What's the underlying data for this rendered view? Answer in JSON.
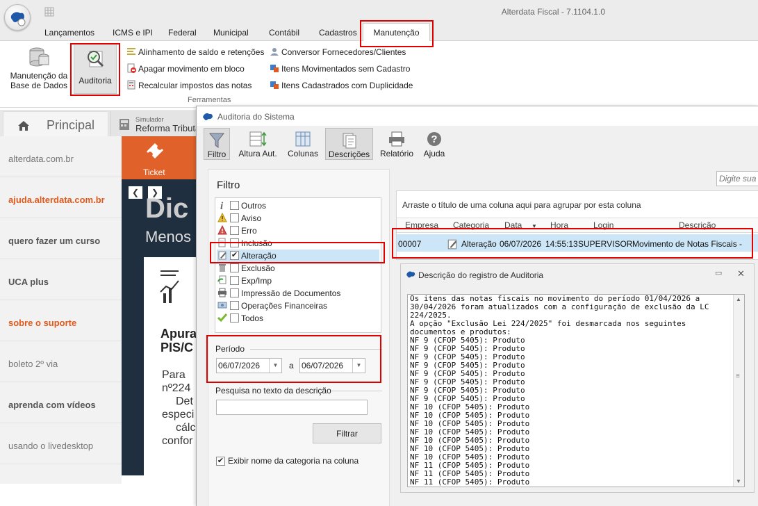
{
  "app": {
    "title": "Alterdata Fiscal - 7.1104.1.0"
  },
  "menu": [
    "Lançamentos",
    "ICMS e IPI",
    "Federal",
    "Municipal",
    "Contábil",
    "Cadastros",
    "Manutenção"
  ],
  "ribbon": {
    "big_buttons": [
      {
        "label_line1": "Manutenção da",
        "label_line2": "Base de Dados"
      },
      {
        "label_line1": "Auditoria"
      }
    ],
    "col1": [
      "Alinhamento de saldo e retenções",
      "Apagar movimento em bloco",
      "Recalcular impostos das notas"
    ],
    "col2": [
      "Conversor Fornecedores/Clientes",
      "Itens Movimentados sem Cadastro",
      "Itens Cadastrados com Duplicidade"
    ],
    "group_label": "Ferramentas"
  },
  "left": {
    "tab_principal": "Principal",
    "tab_sim_small": "Simulador",
    "tab_sim_big": "Reforma Tributár",
    "nav": [
      "alterdata.com.br",
      "ajuda.alterdata.com.br",
      "quero fazer um curso",
      "UCA plus",
      "sobre o suporte",
      "boleto 2º via",
      "aprenda com vídeos",
      "usando o livedesktop"
    ],
    "banner": {
      "ticket": "Ticket",
      "big1": "Dic",
      "big2": "Menos",
      "lines": [
        "Apura",
        "PIS/C",
        "Para",
        "nº224",
        "Det",
        "especi",
        "cálc",
        "confor"
      ]
    }
  },
  "dialog": {
    "title": "Auditoria do Sistema",
    "toolbar": [
      "Filtro",
      "Altura Aut.",
      "Colunas",
      "Descrições",
      "Relatório",
      "Ajuda"
    ],
    "search_placeholder": "Digite sua p",
    "filter": {
      "heading": "Filtro",
      "items": [
        {
          "label": "Outros",
          "checked": false
        },
        {
          "label": "Aviso",
          "checked": false
        },
        {
          "label": "Erro",
          "checked": false
        },
        {
          "label": "Inclusão",
          "checked": false
        },
        {
          "label": "Alteração",
          "checked": true
        },
        {
          "label": "Exclusão",
          "checked": false
        },
        {
          "label": "Exp/Imp",
          "checked": false
        },
        {
          "label": "Impressão de Documentos",
          "checked": false
        },
        {
          "label": "Operações Financeiras",
          "checked": false
        },
        {
          "label": "Todos",
          "checked": false
        }
      ],
      "period_label": "Período",
      "date_from": "06/07/2026",
      "sep": "a",
      "date_to": "06/07/2026",
      "search_label": "Pesquisa no texto da descrição",
      "search_value": "",
      "filter_button": "Filtrar",
      "show_category_label": "Exibir nome da categoria na coluna",
      "show_category_checked": true
    },
    "grid": {
      "group_hint": "Arraste o título de uma coluna aqui para agrupar por esta coluna",
      "headers": [
        "Empresa",
        "Categoria",
        "Data",
        "Hora",
        "Login",
        "Descrição"
      ],
      "row": [
        "00007",
        "Alteração",
        "06/07/2026",
        "14:55:13",
        "SUPERVISOR",
        "Movimento de Notas Fiscais -"
      ]
    },
    "desc": {
      "title": "Descrição do registro de Auditoria",
      "text": "Os itens das notas fiscais no movimento do período 01/04/2026 a\n30/04/2026 foram atualizados com a configuração de exclusão da LC\n224/2025.\nA opção \"Exclusão Lei 224/2025\" foi desmarcada nos seguintes\ndocumentos e produtos:\nNF 9 (CFOP 5405): Produto\nNF 9 (CFOP 5405): Produto\nNF 9 (CFOP 5405): Produto\nNF 9 (CFOP 5405): Produto\nNF 9 (CFOP 5405): Produto\nNF 9 (CFOP 5405): Produto\nNF 9 (CFOP 5405): Produto\nNF 9 (CFOP 5405): Produto\nNF 10 (CFOP 5405): Produto\nNF 10 (CFOP 5405): Produto\nNF 10 (CFOP 5405): Produto\nNF 10 (CFOP 5405): Produto\nNF 10 (CFOP 5405): Produto\nNF 10 (CFOP 5405): Produto\nNF 10 (CFOP 5405): Produto\nNF 11 (CFOP 5405): Produto\nNF 11 (CFOP 5405): Produto\nNF 11 (CFOP 5405): Produto"
    }
  },
  "colors": {
    "accent_red": "#e00000",
    "orange": "#e05a1c",
    "selection": "#cde6f7"
  }
}
